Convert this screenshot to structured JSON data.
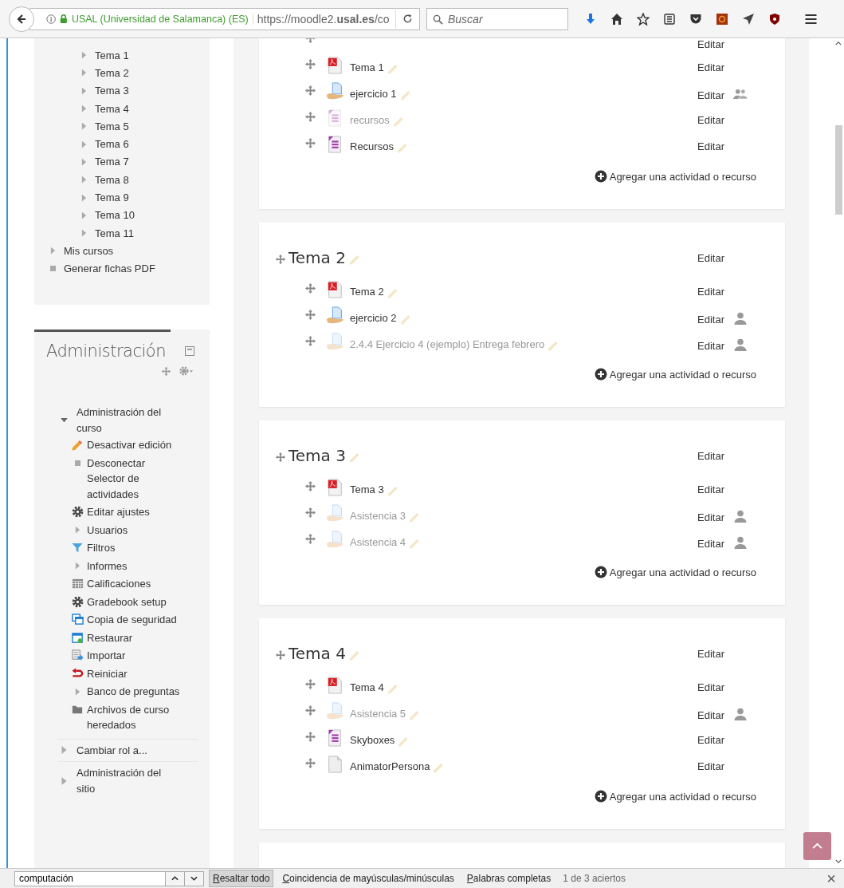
{
  "browser": {
    "identity": "USAL (Universidad de Salamanca) (ES)",
    "url": "https://moodle2.**usal.es**/co",
    "search_placeholder": "Buscar"
  },
  "navigation": {
    "course_sections": [
      "Tema 1",
      "Tema 2",
      "Tema 3",
      "Tema 4",
      "Tema 5",
      "Tema 6",
      "Tema 7",
      "Tema 8",
      "Tema 9",
      "Tema 10",
      "Tema 11"
    ],
    "items": [
      {
        "label": "Mis cursos",
        "kind": "branch"
      },
      {
        "label": "Generar fichas PDF",
        "kind": "leaf"
      }
    ]
  },
  "administration": {
    "title": "Administración",
    "tree": [
      {
        "label": "Administración del curso",
        "expanded": true,
        "children": [
          {
            "label": "Desactivar edición",
            "kind": "edit"
          },
          {
            "label": "Desconectar Selector de actividades",
            "kind": "leaf"
          },
          {
            "label": "Editar ajustes",
            "kind": "settings"
          },
          {
            "label": "Usuarios",
            "kind": "branch"
          },
          {
            "label": "Filtros",
            "kind": "filter"
          },
          {
            "label": "Informes",
            "kind": "branch"
          },
          {
            "label": "Calificaciones",
            "kind": "grades"
          },
          {
            "label": "Gradebook setup",
            "kind": "settings"
          },
          {
            "label": "Copia de seguridad",
            "kind": "backup"
          },
          {
            "label": "Restaurar",
            "kind": "restore"
          },
          {
            "label": "Importar",
            "kind": "import"
          },
          {
            "label": "Reiniciar",
            "kind": "reset"
          },
          {
            "label": "Banco de preguntas",
            "kind": "branch"
          },
          {
            "label": "Archivos de curso heredados",
            "kind": "folder"
          }
        ]
      },
      {
        "label": "Cambiar rol a...",
        "expanded": false
      },
      {
        "label": "Administración del sitio",
        "expanded": false
      }
    ]
  },
  "sections": [
    {
      "items": [
        {
          "kind": "none",
          "edit_label": "Editar"
        },
        {
          "name": "Tema 1",
          "kind": "pdf",
          "dimmed": false,
          "edit_label": "Editar"
        },
        {
          "name": "ejercicio 1",
          "kind": "assign",
          "dimmed": false,
          "edit_label": "Editar",
          "group": {
            "kind": "people"
          }
        },
        {
          "name": "recursos",
          "kind": "page",
          "dimmed": true,
          "edit_label": "Editar"
        },
        {
          "name": "Recursos",
          "kind": "page",
          "dimmed": false,
          "edit_label": "Editar"
        }
      ],
      "add_label": "Agregar una actividad o recurso"
    },
    {
      "title": "Tema 2",
      "edit_label": "Editar",
      "items": [
        {
          "name": "Tema 2",
          "kind": "pdf",
          "dimmed": false,
          "edit_label": "Editar"
        },
        {
          "name": "ejercicio 2",
          "kind": "assign",
          "dimmed": false,
          "edit_label": "Editar",
          "group": {
            "kind": "person"
          }
        },
        {
          "name": "2.4.4 Ejercicio 4 (ejemplo) Entrega febrero",
          "kind": "assign",
          "dimmed": true,
          "edit_label": "Editar",
          "group": {
            "kind": "person"
          }
        }
      ],
      "add_label": "Agregar una actividad o recurso"
    },
    {
      "title": "Tema 3",
      "edit_label": "Editar",
      "items": [
        {
          "name": "Tema 3",
          "kind": "pdf",
          "dimmed": false,
          "edit_label": "Editar"
        },
        {
          "name": "Asistencia 3",
          "kind": "assign",
          "dimmed": true,
          "edit_label": "Editar",
          "group": {
            "kind": "person"
          }
        },
        {
          "name": "Asistencia 4",
          "kind": "assign",
          "dimmed": true,
          "edit_label": "Editar",
          "group": {
            "kind": "person"
          }
        }
      ],
      "add_label": "Agregar una actividad o recurso"
    },
    {
      "title": "Tema 4",
      "edit_label": "Editar",
      "items": [
        {
          "name": "Tema 4",
          "kind": "pdf",
          "dimmed": false,
          "edit_label": "Editar"
        },
        {
          "name": "Asistencia 5",
          "kind": "assign",
          "dimmed": true,
          "edit_label": "Editar",
          "group": {
            "kind": "person"
          }
        },
        {
          "name": "Skyboxes",
          "kind": "page",
          "dimmed": false,
          "edit_label": "Editar"
        },
        {
          "name": "AnimatorPersona",
          "kind": "file",
          "dimmed": false,
          "edit_label": "Editar"
        }
      ],
      "add_label": "Agregar una actividad o recurso"
    }
  ],
  "find_bar": {
    "value": "computación",
    "options": [
      {
        "label": "Resaltar todo",
        "selected": true
      },
      {
        "label": "Coincidencia de mayúsculas/minúsculas",
        "selected": false
      },
      {
        "label": "Palabras completas",
        "selected": false
      }
    ],
    "status": "1 de 3 aciertos",
    "close": "×"
  }
}
